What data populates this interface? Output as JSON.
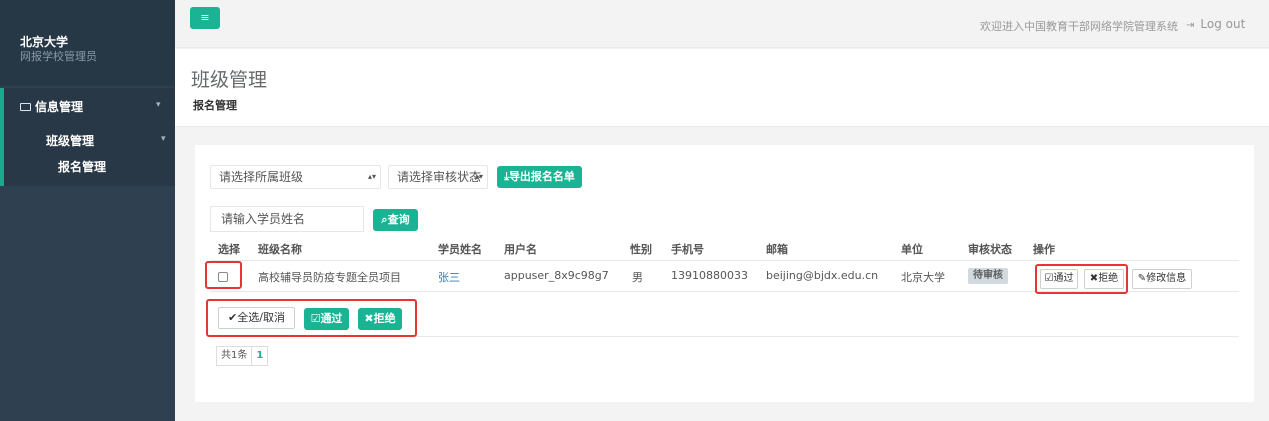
{
  "sidebar": {
    "school": "北京大学",
    "role": "网报学校管理员",
    "menu": {
      "group_label": "信息管理",
      "sub_label": "班级管理",
      "active_item": "报名管理"
    }
  },
  "topbar": {
    "menu_icon": "≡",
    "welcome": "欢迎进入中国教育干部网络学院管理系统",
    "logout": "Log out"
  },
  "heading": {
    "title": "班级管理",
    "breadcrumb": "报名管理"
  },
  "filters": {
    "class_select": "请选择所属班级",
    "status_select": "请选择审核状态",
    "export_label": "导出报名名单",
    "name_placeholder": "请输入学员姓名",
    "search_label": "查询"
  },
  "table": {
    "headers": [
      "选择",
      "班级名称",
      "学员姓名",
      "用户名",
      "性别",
      "手机号",
      "邮箱",
      "单位",
      "审核状态",
      "操作"
    ],
    "rows": [
      {
        "class_name": "高校辅导员防疫专题全员项目",
        "student": "张三",
        "username": "appuser_8x9c98g7",
        "gender": "男",
        "phone": "13910880033",
        "email": "beijing@bjdx.edu.cn",
        "unit": "北京大学",
        "status": "待审核",
        "actions": {
          "approve": "通过",
          "reject": "拒绝",
          "edit": "修改信息"
        }
      }
    ]
  },
  "bulk": {
    "select_all": "全选/取消",
    "approve": "通过",
    "reject": "拒绝"
  },
  "pager": {
    "total": "共1条",
    "current": "1"
  },
  "colors": {
    "primary": "#1ab394",
    "sidebar": "#2f4050",
    "highlight": "#e53535"
  }
}
